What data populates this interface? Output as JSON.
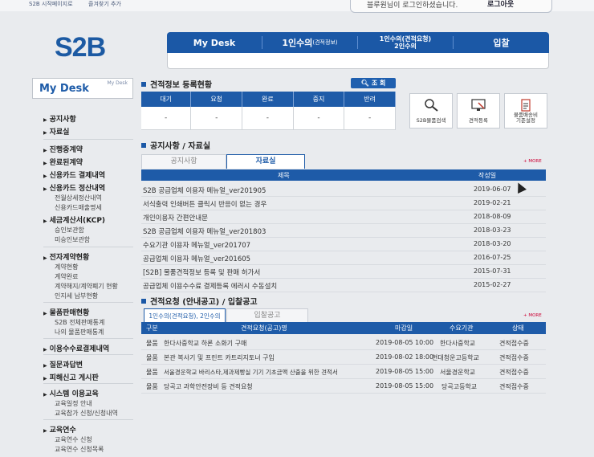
{
  "top": {
    "link1": "S2B 시작페이지로",
    "link2": "즐겨찾기 추가",
    "login_msg": "블루원님이 로그인하셨습니다.",
    "logout": "로그아웃"
  },
  "logo": "S2B",
  "gnb": {
    "mydesk": "My Desk",
    "single_quote": "1인수의",
    "single_quote_sub": "(견적정보)",
    "single_req_1": "1인수의(견적요청)",
    "single_req_2": "2인수의",
    "bid": "입찰"
  },
  "sidebar": {
    "title": "My Desk",
    "title_small": "My Desk",
    "items": [
      {
        "label": "공지사항",
        "type": "m"
      },
      {
        "label": "자료실",
        "type": "m"
      },
      {
        "label": "진행중계약",
        "type": "m"
      },
      {
        "label": "완료된계약",
        "type": "m"
      },
      {
        "label": "신용카드 결제내역",
        "type": "m"
      },
      {
        "label": "신용카드 정산내역",
        "type": "m"
      },
      {
        "label": "전월상세정산내역",
        "type": "s"
      },
      {
        "label": "신용카드매출명세",
        "type": "s"
      },
      {
        "label": "세금계산서(KCP)",
        "type": "m"
      },
      {
        "label": "승인보관함",
        "type": "s"
      },
      {
        "label": "미승인보관함",
        "type": "s"
      },
      {
        "label": "전자계약현황",
        "type": "m"
      },
      {
        "label": "계약현황",
        "type": "s"
      },
      {
        "label": "계약완료",
        "type": "s"
      },
      {
        "label": "계약해지/계약폐기 현황",
        "type": "s"
      },
      {
        "label": "인지세 납부현황",
        "type": "s"
      },
      {
        "label": "물품판매현황",
        "type": "m"
      },
      {
        "label": "S2B 전체판매통계",
        "type": "s"
      },
      {
        "label": "나의 물품판매통계",
        "type": "s"
      },
      {
        "label": "이용수수료결제내역",
        "type": "m"
      },
      {
        "label": "질문과답변",
        "type": "m"
      },
      {
        "label": "피해신고 게시판",
        "type": "m"
      },
      {
        "label": "시스템 이용교육",
        "type": "m"
      },
      {
        "label": "교육일정 안내",
        "type": "s"
      },
      {
        "label": "교육참가 신청/신청내역",
        "type": "s"
      },
      {
        "label": "교육연수",
        "type": "m"
      },
      {
        "label": "교육연수 신청",
        "type": "s"
      },
      {
        "label": "교육연수 신청목록",
        "type": "s"
      }
    ]
  },
  "status": {
    "title": "견적정보 등록현황",
    "search": "조 회",
    "headers": [
      "대기",
      "요청",
      "완료",
      "중지",
      "반려"
    ],
    "values": [
      "-",
      "-",
      "-",
      "-",
      "-"
    ]
  },
  "quick": [
    {
      "label": "S2B물품검색"
    },
    {
      "label": "견적등록"
    },
    {
      "label_1": "물품배송비",
      "label_2": "기준설정"
    }
  ],
  "notice": {
    "title": "공지사항 / 자료실",
    "tab_notice": "공지사항",
    "tab_archive": "자료실",
    "more": "+ MORE",
    "col_title": "제목",
    "col_date": "작성일",
    "rows": [
      {
        "title": "S2B 공급업체 이용자 메뉴얼_ver201905",
        "date": "2019-06-07"
      },
      {
        "title": "서식출력 인쇄버튼 클릭시 반응이 없는 경우",
        "date": "2019-02-21"
      },
      {
        "title": "개인이용자 간편안내문",
        "date": "2018-08-09"
      },
      {
        "title": "S2B 공급업체 이용자 메뉴얼_ver201803",
        "date": "2018-03-23"
      },
      {
        "title": "수요기관 이용자 메뉴얼_ver201707",
        "date": "2018-03-20"
      },
      {
        "title": "공급업체 이용자 메뉴얼_ver201605",
        "date": "2016-07-25"
      },
      {
        "title": "[S2B] 물품견적정보 등록 및 판매 허가서",
        "date": "2015-07-31"
      },
      {
        "title": "공급업체 이용수수료 결제등록 에러시 수동설치",
        "date": "2015-02-27"
      }
    ]
  },
  "bid": {
    "title": "견적요청 (안내공고) / 입찰공고",
    "tab_req": "1인수의(견적요청), 2인수의",
    "tab_bid": "입찰공고",
    "more": "+ MORE",
    "headers": [
      "구분",
      "견적요청(공고)명",
      "마감일",
      "수요기관",
      "상태"
    ],
    "rows": [
      {
        "type": "물품",
        "name": "한다사중학교 하론 소화기 구매",
        "deadline": "2019-08-05 10:00",
        "org": "한다사중학교",
        "status": "견적접수중"
      },
      {
        "type": "물품",
        "name": "본관 복사기 및 프린트 카트리지토너 구입",
        "deadline": "2019-08-02 18:00",
        "org": "현대청운고등학교",
        "status": "견적접수중"
      },
      {
        "type": "물품",
        "name": "서울경운학교 바리스타,제과제빵실 기기 기초금액 산출을 위한 견적서",
        "deadline": "2019-08-05 15:00",
        "org": "서울경운학교",
        "status": "견적접수중"
      },
      {
        "type": "물품",
        "name": "당곡고 과학안전장비 등 견적요청",
        "deadline": "2019-08-05 15:00",
        "org": "당곡고등학교",
        "status": "견적접수중"
      }
    ]
  }
}
